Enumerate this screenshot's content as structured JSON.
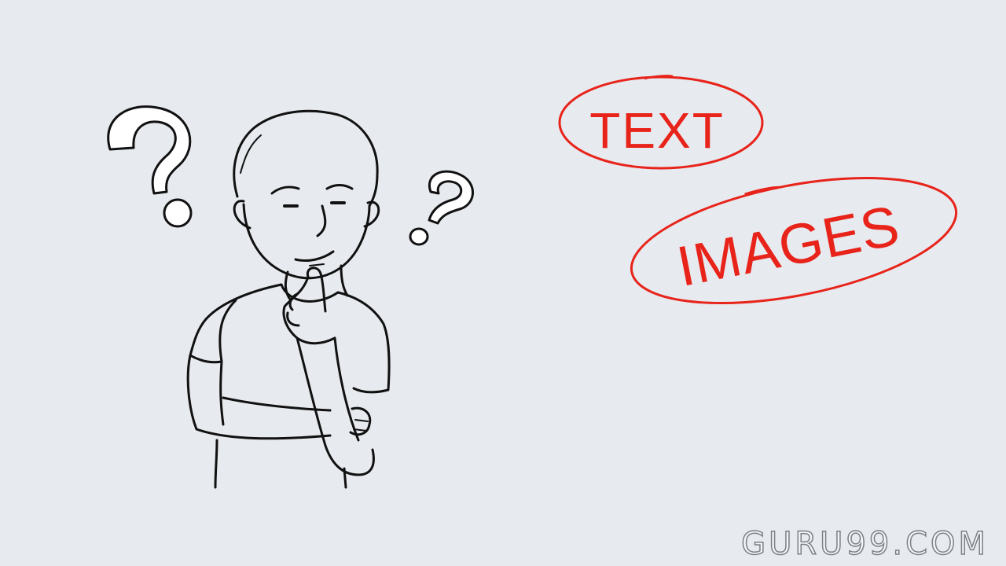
{
  "labels": {
    "text": "TEXT",
    "images": "IMAGES"
  },
  "watermark": "GURU99.COM",
  "colors": {
    "background": "#e7eaef",
    "accent": "#e8231a",
    "ink": "#111111"
  },
  "icons": [
    "thinking-person-illustration",
    "question-mark-icon",
    "question-mark-icon"
  ]
}
